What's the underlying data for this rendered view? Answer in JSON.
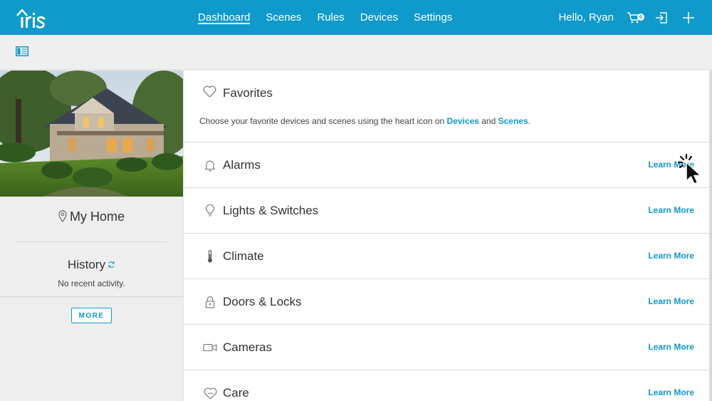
{
  "app": {
    "logo_text": "iris",
    "brand_color": "#0f9acb"
  },
  "nav": {
    "items": [
      {
        "label": "Dashboard",
        "active": true
      },
      {
        "label": "Scenes",
        "active": false
      },
      {
        "label": "Rules",
        "active": false
      },
      {
        "label": "Devices",
        "active": false
      },
      {
        "label": "Settings",
        "active": false
      }
    ],
    "greeting": "Hello, Ryan",
    "cart_count": "0",
    "icons": [
      "cart-icon",
      "exit-icon",
      "plus-icon"
    ]
  },
  "toolbar": {
    "icons": [
      "sidebar-toggle-icon"
    ]
  },
  "left_panel": {
    "place_name": "My Home",
    "history_title": "History",
    "history_empty": "No recent activity.",
    "more_label": "MORE"
  },
  "favorites": {
    "title": "Favorites",
    "desc_prefix": "Choose your favorite devices and scenes using the heart icon on ",
    "link_devices": "Devices",
    "desc_and": " and ",
    "link_scenes": "Scenes",
    "desc_suffix": "."
  },
  "cards": [
    {
      "label": "Alarms",
      "icon": "bell-icon",
      "link": "Learn More"
    },
    {
      "label": "Lights & Switches",
      "icon": "lightbulb-icon",
      "link": "Learn More"
    },
    {
      "label": "Climate",
      "icon": "thermometer-icon",
      "link": "Learn More"
    },
    {
      "label": "Doors & Locks",
      "icon": "lock-icon",
      "link": "Learn More"
    },
    {
      "label": "Cameras",
      "icon": "camera-icon",
      "link": "Learn More"
    },
    {
      "label": "Care",
      "icon": "heart-hand-icon",
      "link": "Learn More"
    }
  ]
}
